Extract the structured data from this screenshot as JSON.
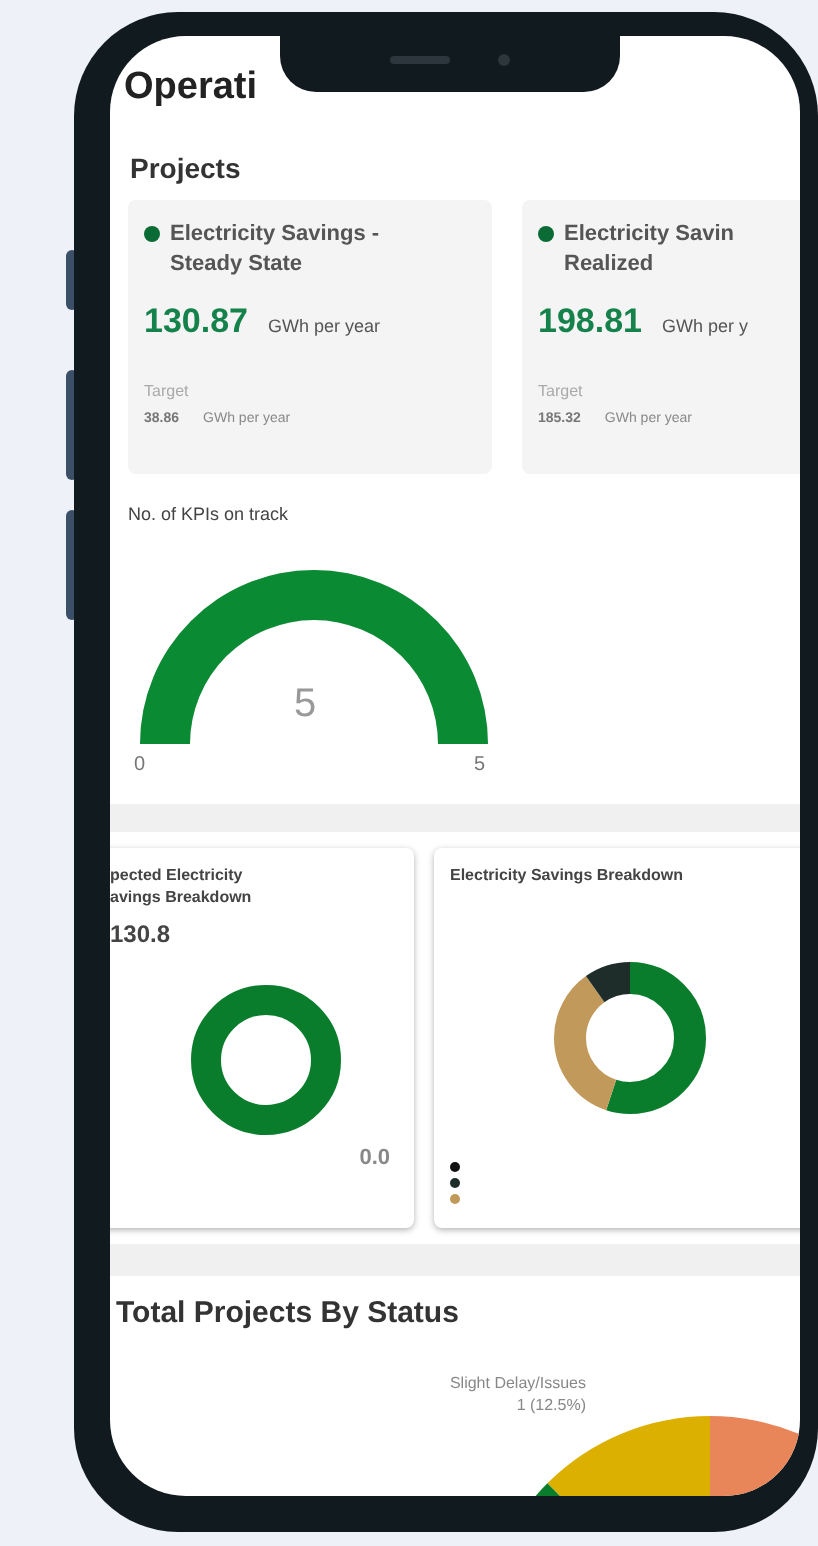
{
  "header": {
    "title": "Operati"
  },
  "projects": {
    "title": "Projects",
    "cards": [
      {
        "title_lines": [
          "Electricity Savings -",
          "Steady State"
        ],
        "value": "130.87",
        "unit": "GWh per year",
        "target_label": "Target",
        "target_value": "38.86",
        "target_unit": "GWh per year"
      },
      {
        "title_lines": [
          "Electricity Savin",
          "Realized"
        ],
        "value": "198.81",
        "unit": "GWh per y",
        "target_label": "Target",
        "target_value": "185.32",
        "target_unit": "GWh per year"
      }
    ]
  },
  "kpi_gauge": {
    "title": "No. of KPIs on track",
    "value": "5",
    "min": "0",
    "max": "5",
    "level": 1
  },
  "breakdown_cards": [
    {
      "title_lines": [
        "pected Electricity",
        "avings Breakdown"
      ],
      "value": "130.8",
      "side_value": "0.0"
    },
    {
      "title_lines": [
        "Electricity Savings Breakdown"
      ]
    }
  ],
  "status_chart": {
    "title": "Total Projects By Status",
    "label": "Slight Delay/Issues",
    "label_value": "1 (12.5%)"
  }
}
